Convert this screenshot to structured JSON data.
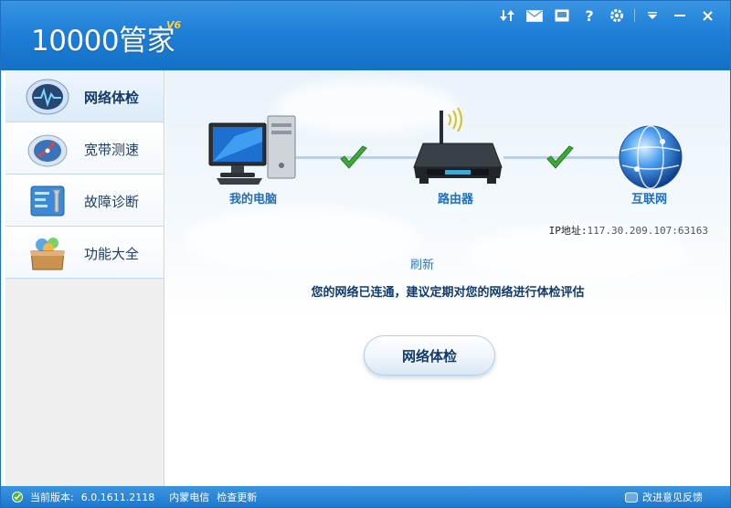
{
  "window": {
    "app_title": "10000管家",
    "app_version": "V6"
  },
  "titlebar_icons": [
    "refresh-arrows-icon",
    "mail-icon",
    "skin-icon",
    "help-icon",
    "settings-icon",
    "menu-dropdown-icon",
    "minimize-icon",
    "close-icon"
  ],
  "sidebar": {
    "items": [
      {
        "label": "网络体检",
        "icon": "network-check-icon",
        "active": true
      },
      {
        "label": "宽带测速",
        "icon": "speedometer-icon",
        "active": false
      },
      {
        "label": "故障诊断",
        "icon": "diagnosis-tool-icon",
        "active": false
      },
      {
        "label": "功能大全",
        "icon": "toolbox-icon",
        "active": false
      }
    ]
  },
  "topology": {
    "computer_label": "我的电脑",
    "router_label": "路由器",
    "internet_label": "互联网"
  },
  "ip_info": {
    "label": "IP地址:",
    "value": "117.30.209.107:63163"
  },
  "refresh_label": "刷新",
  "status_message": "您的网络已连通，建议定期对您的网络进行体检评估",
  "check_button_label": "网络体检",
  "statusbar": {
    "version_label": "当前版本:",
    "version_value": "6.0.1611.2118",
    "isp": "内蒙电信",
    "update_link": "检查更新",
    "feedback_link": "改进意见反馈"
  },
  "colors": {
    "titlebar": "#1f7fd6",
    "accent": "#1f6fc0",
    "check_green": "#3fa83a",
    "version_badge": "#ffd23c"
  }
}
